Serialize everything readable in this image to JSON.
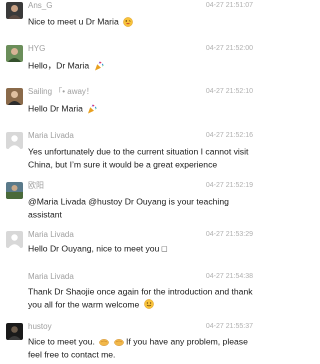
{
  "messages": [
    {
      "id": "m1",
      "sender": "Ans_G",
      "time": "04-27 21:51:07",
      "avatar": "portrait-avatar-dark",
      "text": "Nice to meet u Dr Maria",
      "emojis": [
        "cheeky-face-icon"
      ]
    },
    {
      "id": "m2",
      "sender": "HYG",
      "time": "04-27 21:52:00",
      "avatar": "portrait-avatar-green",
      "text": "Hello，Dr Maria",
      "emojis": [
        "party-popper-icon"
      ]
    },
    {
      "id": "m3",
      "sender": "Sailing 「• away！",
      "time": "04-27 21:52:10",
      "avatar": "portrait-avatar-photo",
      "text": "Hello Dr Maria",
      "emojis": [
        "party-popper-icon"
      ]
    },
    {
      "id": "m4",
      "sender": "Maria Livada",
      "time": "04-27 21:52:16",
      "avatar": "default-avatar-gray",
      "text": "Yes unfortunately due to the current situation I cannot visit China, but I’m sure it would be a great experience",
      "emojis": []
    },
    {
      "id": "m5",
      "sender": "欧阳",
      "time": "04-27 21:52:19",
      "avatar": "portrait-avatar-landscape",
      "text": "@Maria Livada @hustoy Dr Ouyang is your teaching assistant",
      "emojis": []
    },
    {
      "id": "m6",
      "sender": "Maria Livada",
      "time": "04-27 21:53:29",
      "avatar": "default-avatar-gray",
      "text": "Hello Dr Ouyang, nice to meet you □",
      "emojis": []
    },
    {
      "id": "m7",
      "sender": "Maria Livada",
      "time": "04-27 21:54:38",
      "avatar": "none",
      "text": "Thank Dr Shaojie once again for the introduction and thank you all for the warm welcome",
      "emojis": [
        "smiling-face-icon"
      ]
    },
    {
      "id": "m8",
      "sender": "hustoy",
      "time": "04-27 21:55:37",
      "avatar": "portrait-avatar-night",
      "text": "",
      "text_parts": [
        "Nice to meet you.",
        "If you have any problem, please feel free to contact me."
      ],
      "emojis": [
        "handshake-icon",
        "handshake-icon"
      ]
    }
  ]
}
